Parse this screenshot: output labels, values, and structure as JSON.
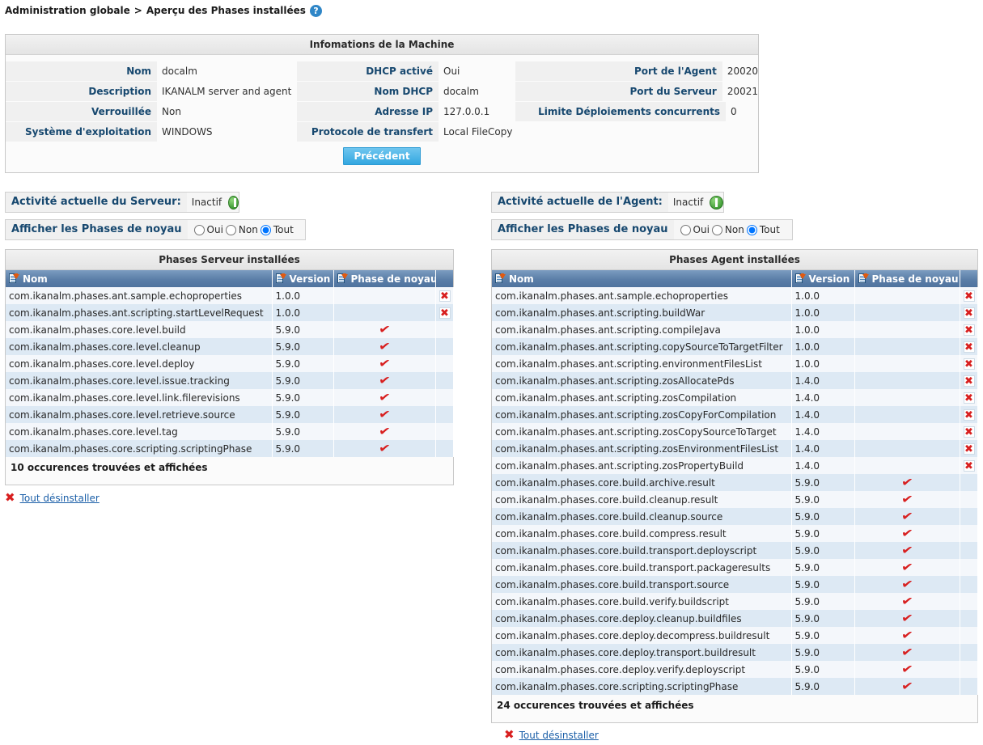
{
  "breadcrumb": {
    "root": "Administration globale",
    "separator": ">",
    "current": "Aperçu des Phases installées",
    "help_icon": "help-icon",
    "help_glyph": "?"
  },
  "machine": {
    "title": "Infomations de la Machine",
    "column1": [
      {
        "label": "Nom",
        "value": "docalm"
      },
      {
        "label": "Description",
        "value": "IKANALM server and agent"
      },
      {
        "label": "Verrouillée",
        "value": "Non"
      },
      {
        "label": "Système d'exploitation",
        "value": "WINDOWS"
      }
    ],
    "column2": [
      {
        "label": "DHCP activé",
        "value": "Oui"
      },
      {
        "label": "Nom DHCP",
        "value": "docalm"
      },
      {
        "label": "Adresse IP",
        "value": "127.0.0.1"
      },
      {
        "label": "Protocole de transfert",
        "value": "Local FileCopy"
      }
    ],
    "column3": [
      {
        "label": "Port de l'Agent",
        "value": "20020"
      },
      {
        "label": "Port du Serveur",
        "value": "20021"
      },
      {
        "label": "Limite Déploiements concurrents",
        "value": "0"
      }
    ],
    "back_button": "Précédent"
  },
  "server": {
    "status_label": "Activité actuelle du Serveur:",
    "status_value": "Inactif",
    "status_icon": "stopped-green-icon",
    "filter_label": "Afficher les Phases de noyau",
    "filter_options": [
      "Oui",
      "Non",
      "Tout"
    ],
    "filter_selected": "Tout",
    "table_title": "Phases Serveur installées",
    "columns": [
      "Nom",
      "Version",
      "Phase de noyau",
      ""
    ],
    "rows": [
      {
        "name": "com.ikanalm.phases.ant.sample.echoproperties",
        "version": "1.0.0",
        "core": false,
        "removable": true
      },
      {
        "name": "com.ikanalm.phases.ant.scripting.startLevelRequest",
        "version": "1.0.0",
        "core": false,
        "removable": true
      },
      {
        "name": "com.ikanalm.phases.core.level.build",
        "version": "5.9.0",
        "core": true,
        "removable": false
      },
      {
        "name": "com.ikanalm.phases.core.level.cleanup",
        "version": "5.9.0",
        "core": true,
        "removable": false
      },
      {
        "name": "com.ikanalm.phases.core.level.deploy",
        "version": "5.9.0",
        "core": true,
        "removable": false
      },
      {
        "name": "com.ikanalm.phases.core.level.issue.tracking",
        "version": "5.9.0",
        "core": true,
        "removable": false
      },
      {
        "name": "com.ikanalm.phases.core.level.link.filerevisions",
        "version": "5.9.0",
        "core": true,
        "removable": false
      },
      {
        "name": "com.ikanalm.phases.core.level.retrieve.source",
        "version": "5.9.0",
        "core": true,
        "removable": false
      },
      {
        "name": "com.ikanalm.phases.core.level.tag",
        "version": "5.9.0",
        "core": true,
        "removable": false
      },
      {
        "name": "com.ikanalm.phases.core.scripting.scriptingPhase",
        "version": "5.9.0",
        "core": true,
        "removable": false
      }
    ],
    "footer": "10 occurences trouvées et affichées",
    "uninstall_all": "Tout désinstaller"
  },
  "agent": {
    "status_label": "Activité actuelle de l'Agent:",
    "status_value": "Inactif",
    "status_icon": "stopped-green-icon",
    "filter_label": "Afficher les Phases de noyau",
    "filter_options": [
      "Oui",
      "Non",
      "Tout"
    ],
    "filter_selected": "Tout",
    "table_title": "Phases Agent installées",
    "columns": [
      "Nom",
      "Version",
      "Phase de noyau",
      ""
    ],
    "rows": [
      {
        "name": "com.ikanalm.phases.ant.sample.echoproperties",
        "version": "1.0.0",
        "core": false,
        "removable": true
      },
      {
        "name": "com.ikanalm.phases.ant.scripting.buildWar",
        "version": "1.0.0",
        "core": false,
        "removable": true
      },
      {
        "name": "com.ikanalm.phases.ant.scripting.compileJava",
        "version": "1.0.0",
        "core": false,
        "removable": true
      },
      {
        "name": "com.ikanalm.phases.ant.scripting.copySourceToTargetFilter",
        "version": "1.0.0",
        "core": false,
        "removable": true
      },
      {
        "name": "com.ikanalm.phases.ant.scripting.environmentFilesList",
        "version": "1.0.0",
        "core": false,
        "removable": true
      },
      {
        "name": "com.ikanalm.phases.ant.scripting.zosAllocatePds",
        "version": "1.4.0",
        "core": false,
        "removable": true
      },
      {
        "name": "com.ikanalm.phases.ant.scripting.zosCompilation",
        "version": "1.4.0",
        "core": false,
        "removable": true
      },
      {
        "name": "com.ikanalm.phases.ant.scripting.zosCopyForCompilation",
        "version": "1.4.0",
        "core": false,
        "removable": true
      },
      {
        "name": "com.ikanalm.phases.ant.scripting.zosCopySourceToTarget",
        "version": "1.4.0",
        "core": false,
        "removable": true
      },
      {
        "name": "com.ikanalm.phases.ant.scripting.zosEnvironmentFilesList",
        "version": "1.4.0",
        "core": false,
        "removable": true
      },
      {
        "name": "com.ikanalm.phases.ant.scripting.zosPropertyBuild",
        "version": "1.4.0",
        "core": false,
        "removable": true
      },
      {
        "name": "com.ikanalm.phases.core.build.archive.result",
        "version": "5.9.0",
        "core": true,
        "removable": false
      },
      {
        "name": "com.ikanalm.phases.core.build.cleanup.result",
        "version": "5.9.0",
        "core": true,
        "removable": false
      },
      {
        "name": "com.ikanalm.phases.core.build.cleanup.source",
        "version": "5.9.0",
        "core": true,
        "removable": false
      },
      {
        "name": "com.ikanalm.phases.core.build.compress.result",
        "version": "5.9.0",
        "core": true,
        "removable": false
      },
      {
        "name": "com.ikanalm.phases.core.build.transport.deployscript",
        "version": "5.9.0",
        "core": true,
        "removable": false
      },
      {
        "name": "com.ikanalm.phases.core.build.transport.packageresults",
        "version": "5.9.0",
        "core": true,
        "removable": false
      },
      {
        "name": "com.ikanalm.phases.core.build.transport.source",
        "version": "5.9.0",
        "core": true,
        "removable": false
      },
      {
        "name": "com.ikanalm.phases.core.build.verify.buildscript",
        "version": "5.9.0",
        "core": true,
        "removable": false
      },
      {
        "name": "com.ikanalm.phases.core.deploy.cleanup.buildfiles",
        "version": "5.9.0",
        "core": true,
        "removable": false
      },
      {
        "name": "com.ikanalm.phases.core.deploy.decompress.buildresult",
        "version": "5.9.0",
        "core": true,
        "removable": false
      },
      {
        "name": "com.ikanalm.phases.core.deploy.transport.buildresult",
        "version": "5.9.0",
        "core": true,
        "removable": false
      },
      {
        "name": "com.ikanalm.phases.core.deploy.verify.deployscript",
        "version": "5.9.0",
        "core": true,
        "removable": false
      },
      {
        "name": "com.ikanalm.phases.core.scripting.scriptingPhase",
        "version": "5.9.0",
        "core": true,
        "removable": false
      }
    ],
    "footer": "24 occurences trouvées et affichées",
    "uninstall_all": "Tout désinstaller"
  },
  "colors": {
    "label_text": "#17486f",
    "header_blue": "#5b7ea8",
    "accent_red": "#d81f1f",
    "link_blue": "#1b5fa8",
    "status_green": "#3f9c35",
    "button_blue": "#33a7e0"
  }
}
